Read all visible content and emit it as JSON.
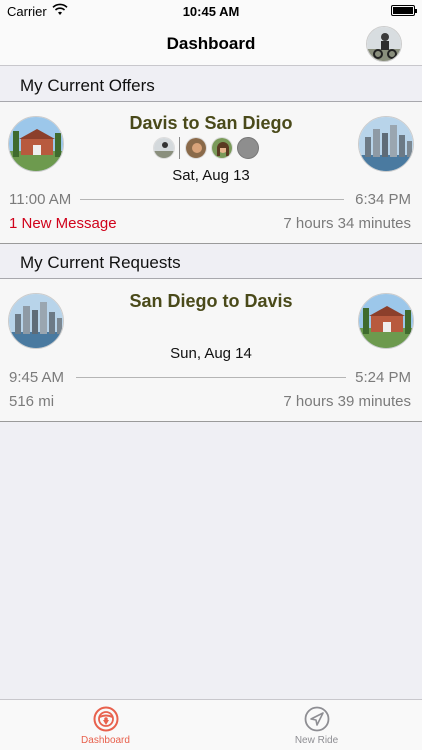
{
  "status_bar": {
    "carrier": "Carrier",
    "time": "10:45 AM"
  },
  "nav": {
    "title": "Dashboard"
  },
  "offers_section": {
    "title": "My Current Offers"
  },
  "offer": {
    "route": "Davis to San Diego",
    "date": "Sat, Aug 13",
    "depart_time": "11:00 AM",
    "arrive_time": "6:34 PM",
    "message": "1 New Message",
    "duration": "7 hours 34 minutes"
  },
  "requests_section": {
    "title": "My Current Requests"
  },
  "request": {
    "route": "San Diego to Davis",
    "date": "Sun, Aug 14",
    "depart_time": "9:45 AM",
    "arrive_time": "5:24 PM",
    "distance": "516 mi",
    "duration": "7 hours 39 minutes"
  },
  "tabs": [
    {
      "label": "Dashboard",
      "icon": "steering-wheel-icon",
      "active": true
    },
    {
      "label": "New Ride",
      "icon": "navigation-arrow-icon",
      "active": false
    }
  ],
  "colors": {
    "accent": "#e8614d",
    "route_title": "#4a4a1a",
    "message": "#d0021b"
  }
}
